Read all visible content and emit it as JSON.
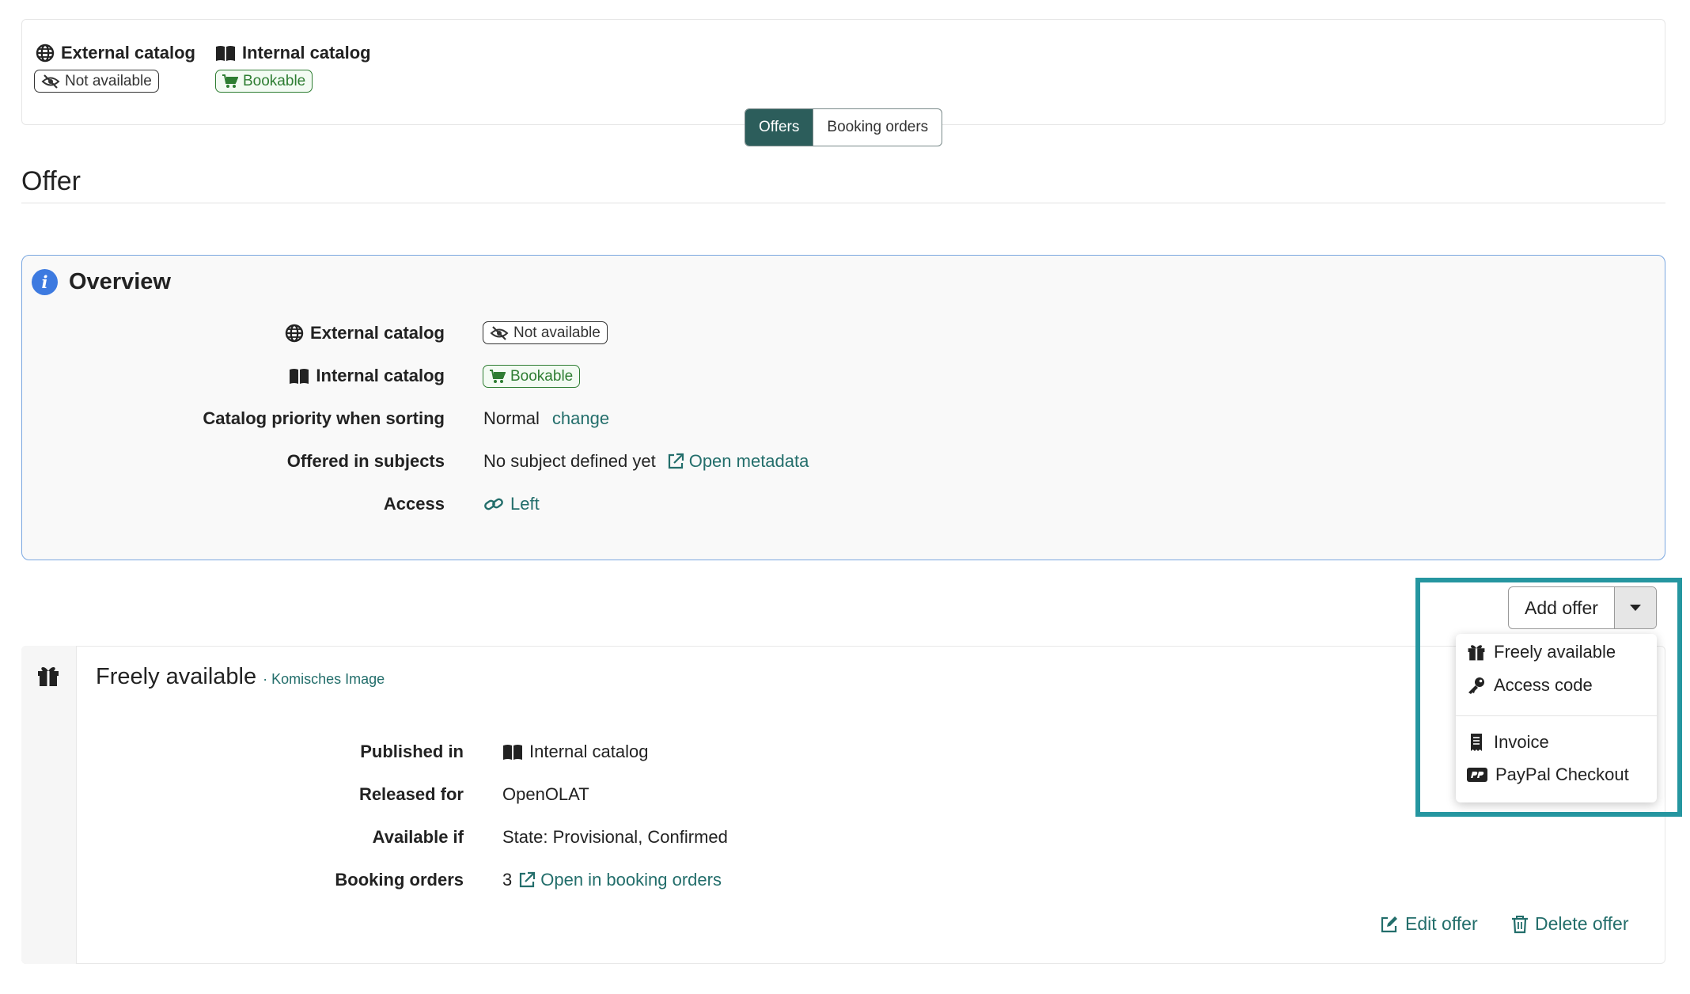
{
  "top_summary": {
    "external_catalog_label": "External catalog",
    "external_status": "Not available",
    "internal_catalog_label": "Internal catalog",
    "internal_status": "Bookable"
  },
  "tabs": {
    "offers": "Offers",
    "booking_orders": "Booking orders",
    "active": "Offers"
  },
  "section_title": "Offer",
  "overview": {
    "title": "Overview",
    "rows": {
      "external_catalog": {
        "label": "External catalog",
        "value": "Not available"
      },
      "internal_catalog": {
        "label": "Internal catalog",
        "value": "Bookable"
      },
      "priority": {
        "label": "Catalog priority when sorting",
        "value": "Normal",
        "link": "change"
      },
      "subjects": {
        "label": "Offered in subjects",
        "value": "No subject defined yet",
        "link": "Open metadata"
      },
      "access": {
        "label": "Access",
        "link": "Left"
      }
    }
  },
  "add_offer": {
    "label": "Add offer",
    "menu": {
      "freely_available": "Freely available",
      "access_code": "Access code",
      "invoice": "Invoice",
      "paypal_checkout": "PayPal Checkout"
    }
  },
  "offer_card": {
    "title": "Freely available",
    "subtitle": "· Komisches Image",
    "rows": {
      "published_in": {
        "label": "Published in",
        "value": "Internal catalog"
      },
      "released_for": {
        "label": "Released for",
        "value": "OpenOLAT"
      },
      "available_if": {
        "label": "Available if",
        "value": "State: Provisional, Confirmed"
      },
      "booking_orders": {
        "label": "Booking orders",
        "value": "3",
        "link": "Open in booking orders"
      }
    },
    "edit_label": "Edit offer",
    "delete_label": "Delete offer"
  },
  "colors": {
    "accent": "#2c5d5b",
    "link": "#236e6b",
    "highlight": "#2596a0",
    "bookable": "#2e7d32",
    "info": "#3d7ae0"
  }
}
